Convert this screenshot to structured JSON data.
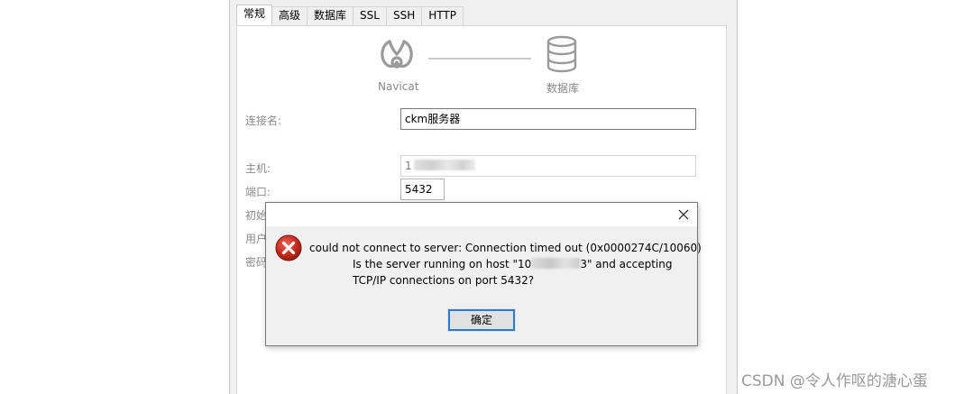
{
  "tabs": [
    "常规",
    "高级",
    "数据库",
    "SSL",
    "SSH",
    "HTTP"
  ],
  "diagram": {
    "left_caption": "Navicat",
    "right_caption": "数据库"
  },
  "form": {
    "connection_name_label": "连接名:",
    "connection_name_value": "ckm服务器",
    "host_label": "主机:",
    "host_value_prefix": "1",
    "port_label": "端口:",
    "port_value": "5432",
    "initial_db_label_partial": "初始",
    "user_label_partial": "用户",
    "password_label_partial": "密码"
  },
  "dialog": {
    "line1": "could not connect to server: Connection timed out (0x0000274C/10060)",
    "line2_prefix": "Is the server running on host \"10",
    "line2_suffix": "3\" and accepting",
    "line3": "TCP/IP connections on port 5432?",
    "ok_label": "确定",
    "icons": {
      "error": "error-circle-icon",
      "close": "close-icon"
    },
    "colors": {
      "error_red": "#c42b1c",
      "focus_blue": "#2b79d8"
    }
  },
  "watermark": "CSDN @令人作呕的溏心蛋"
}
